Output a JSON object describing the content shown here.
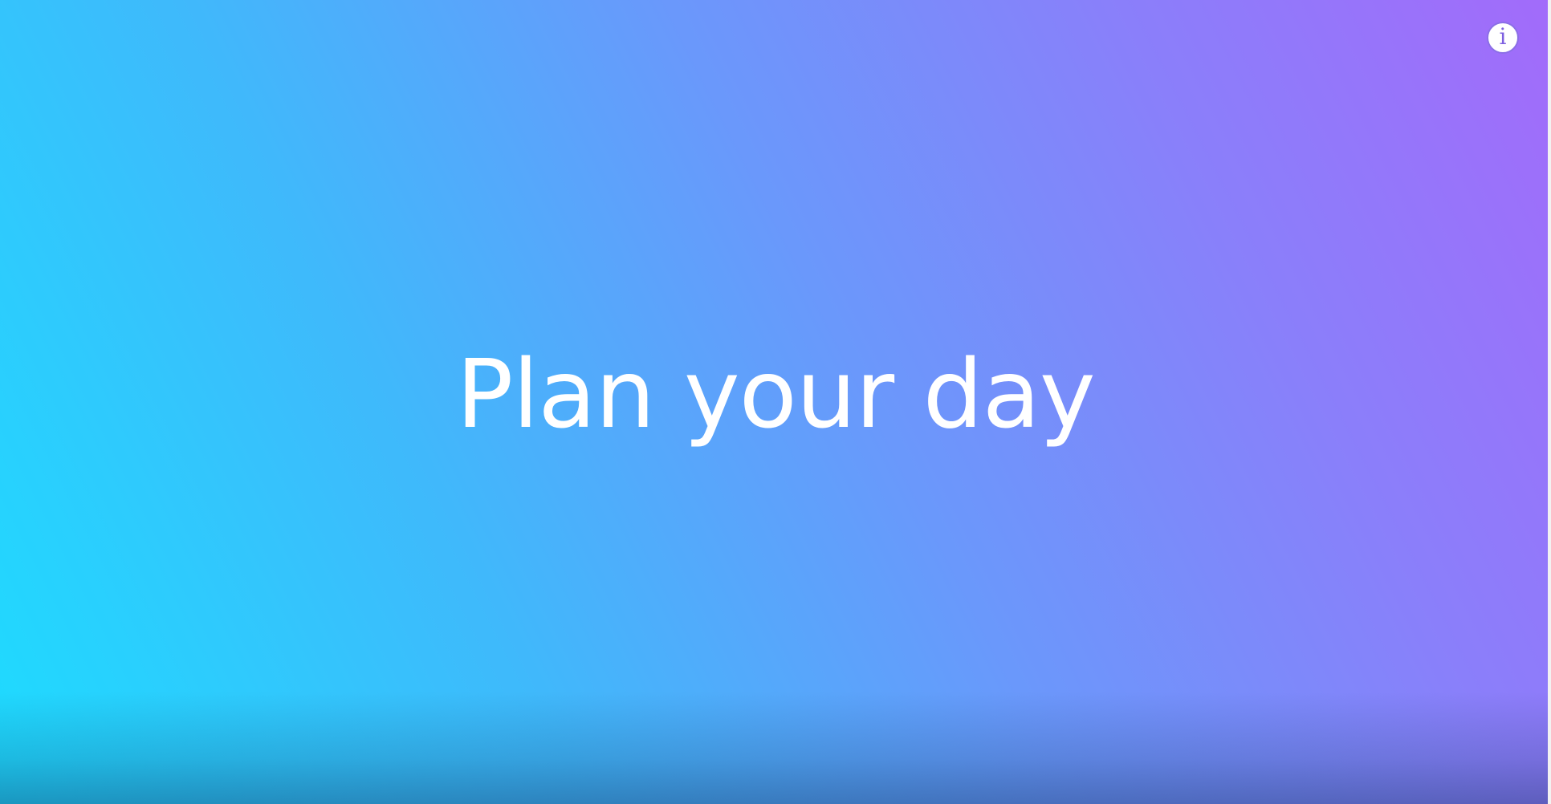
{
  "slide": {
    "headline": "Plan your day"
  },
  "controls": {
    "info_glyph": "i",
    "info_icon": "info-icon"
  },
  "colors": {
    "gradient_start": "#1ddcff",
    "gradient_end": "#a26bfa",
    "text": "#ffffff",
    "info_accent": "#8b6fe6"
  }
}
